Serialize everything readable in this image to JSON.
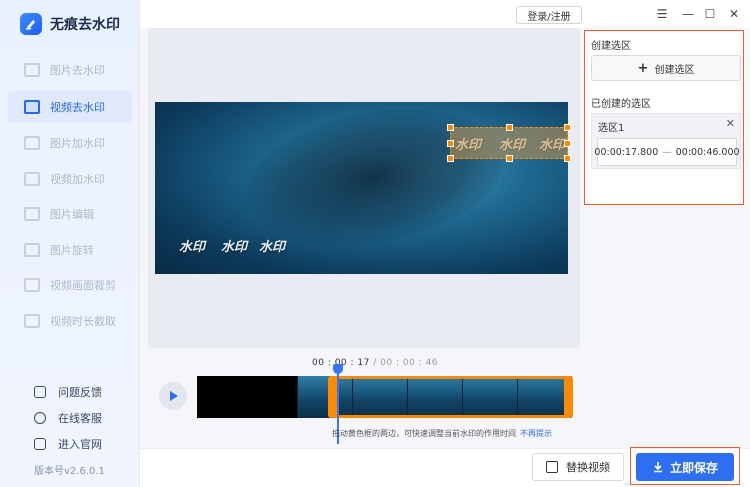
{
  "app": {
    "title": "无痕去水印"
  },
  "sidebar": {
    "items": [
      {
        "label": "图片去水印",
        "active": false
      },
      {
        "label": "视频去水印",
        "active": true
      },
      {
        "label": "图片加水印",
        "active": false
      },
      {
        "label": "视频加水印",
        "active": false
      },
      {
        "label": "图片编辑",
        "active": false
      },
      {
        "label": "图片旋转",
        "active": false
      },
      {
        "label": "视频画面裁剪",
        "active": false
      },
      {
        "label": "视频时长截取",
        "active": false
      }
    ],
    "footer": [
      {
        "label": "问题反馈",
        "icon": "feedback-icon"
      },
      {
        "label": "在线客服",
        "icon": "support-icon"
      },
      {
        "label": "进入官网",
        "icon": "website-icon"
      }
    ],
    "version": "版本号v2.6.0.1"
  },
  "topbar": {
    "login": "登录/注册"
  },
  "video": {
    "watermarks": [
      "水印",
      "水印",
      "水印",
      "水印",
      "水印",
      "水印"
    ]
  },
  "timeline": {
    "current": "00 : 00 : 17",
    "total": " / 00 : 00 : 46",
    "hint": "拖动黄色框的两边，可快速调整当前水印的作用时间",
    "hint_link": "不再提示"
  },
  "panel": {
    "title": "创建选区",
    "create_button": "创建选区",
    "subtitle": "已创建的选区",
    "region": {
      "name": "选区1",
      "start": "00:00:17.800",
      "sep": "—",
      "end": "00:00:46.000"
    }
  },
  "bottombar": {
    "replace_button": "替换视频",
    "save_button": "立即保存"
  },
  "colors": {
    "accent": "#2e6ef0",
    "range": "#ff8a00",
    "highlight": "#f15a2b"
  }
}
